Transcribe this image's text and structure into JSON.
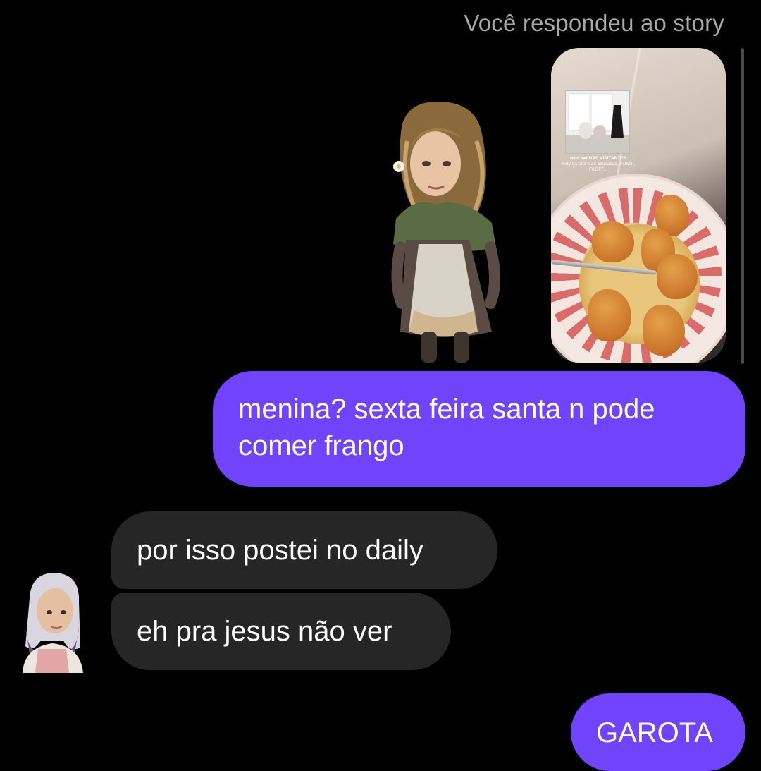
{
  "story_reply": {
    "label": "Você respondeu ao story",
    "mini_caption_title": "mini set DAS VISITANTES",
    "mini_caption_body": "Katy da Voz e as abusadas, FUSO!, FKOFF..."
  },
  "messages": [
    {
      "direction": "sent",
      "text": "menina? sexta feira santa n pode comer frango"
    },
    {
      "direction": "received",
      "text": "por isso postei no daily"
    },
    {
      "direction": "received",
      "text": "eh pra jesus não ver"
    },
    {
      "direction": "sent",
      "text": "GAROTA"
    }
  ],
  "colors": {
    "background": "#000000",
    "sent_bubble": "#6f44fb",
    "received_bubble": "#262626",
    "meta_text": "#a8a8a8"
  },
  "icons": [
    "character-sticker",
    "contact-avatar",
    "story-thumbnail"
  ]
}
